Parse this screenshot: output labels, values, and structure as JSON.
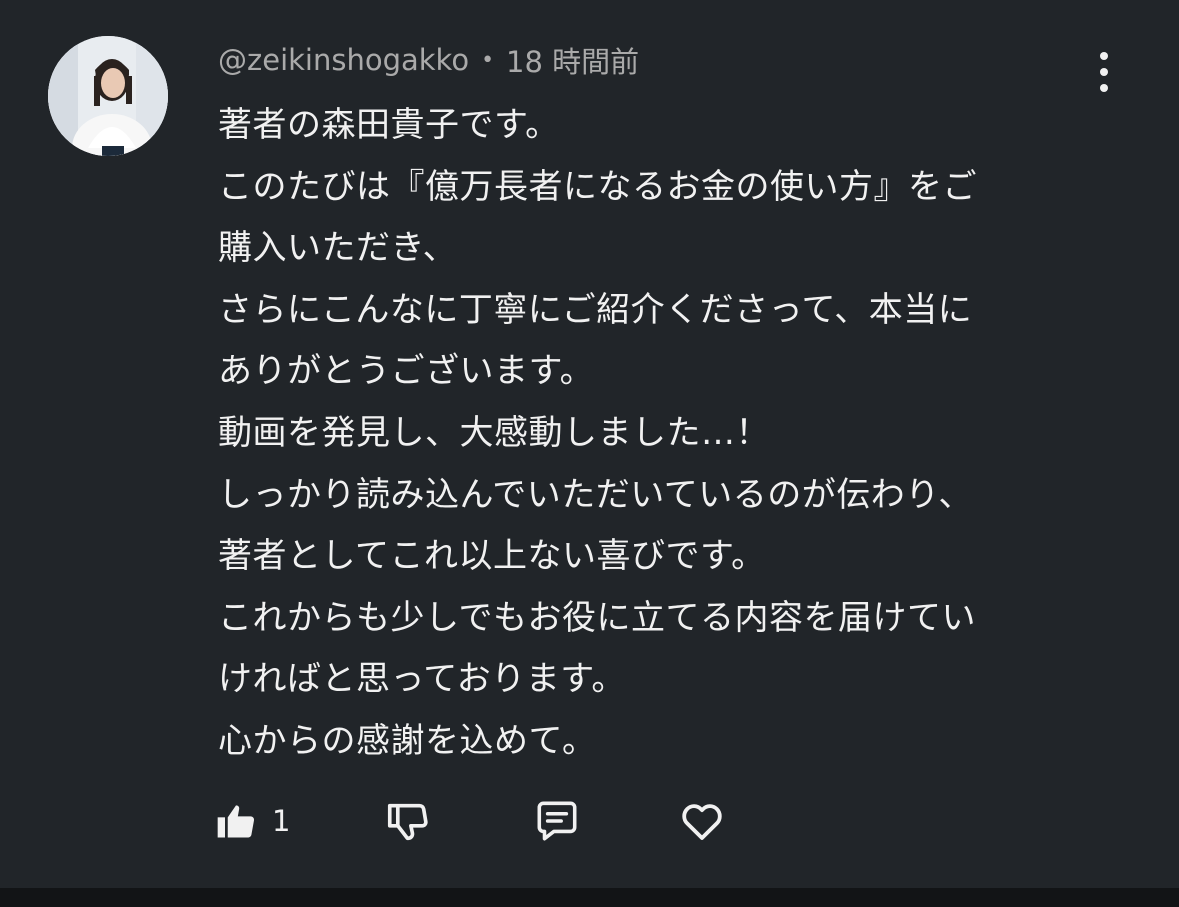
{
  "comment": {
    "author": "@zeikinshogakko",
    "separator": "•",
    "timestamp": "18 時間前",
    "lines": [
      "著者の森田貴子です。",
      "このたびは『億万長者になるお金の使い方』をご",
      "購入いただき、",
      "さらにこんなに丁寧にご紹介くださって、本当に",
      "ありがとうございます。",
      "動画を発見し、大感動しました…！",
      "しっかり読み込んでいただいているのが伝わり、",
      "著者としてこれ以上ない喜びです。",
      "これからも少しでもお役に立てる内容を届けてい",
      "ければと思っております。",
      "心からの感謝を込めて。"
    ],
    "like_count": "1"
  },
  "icons": {
    "like": "thumbs-up-icon",
    "dislike": "thumbs-down-icon",
    "reply": "comment-icon",
    "heart": "heart-icon",
    "menu": "more-vertical-icon"
  },
  "colors": {
    "background": "#212529",
    "text": "#f1f1f1",
    "meta": "#aaaaaa",
    "bottom_bar": "#121416"
  }
}
